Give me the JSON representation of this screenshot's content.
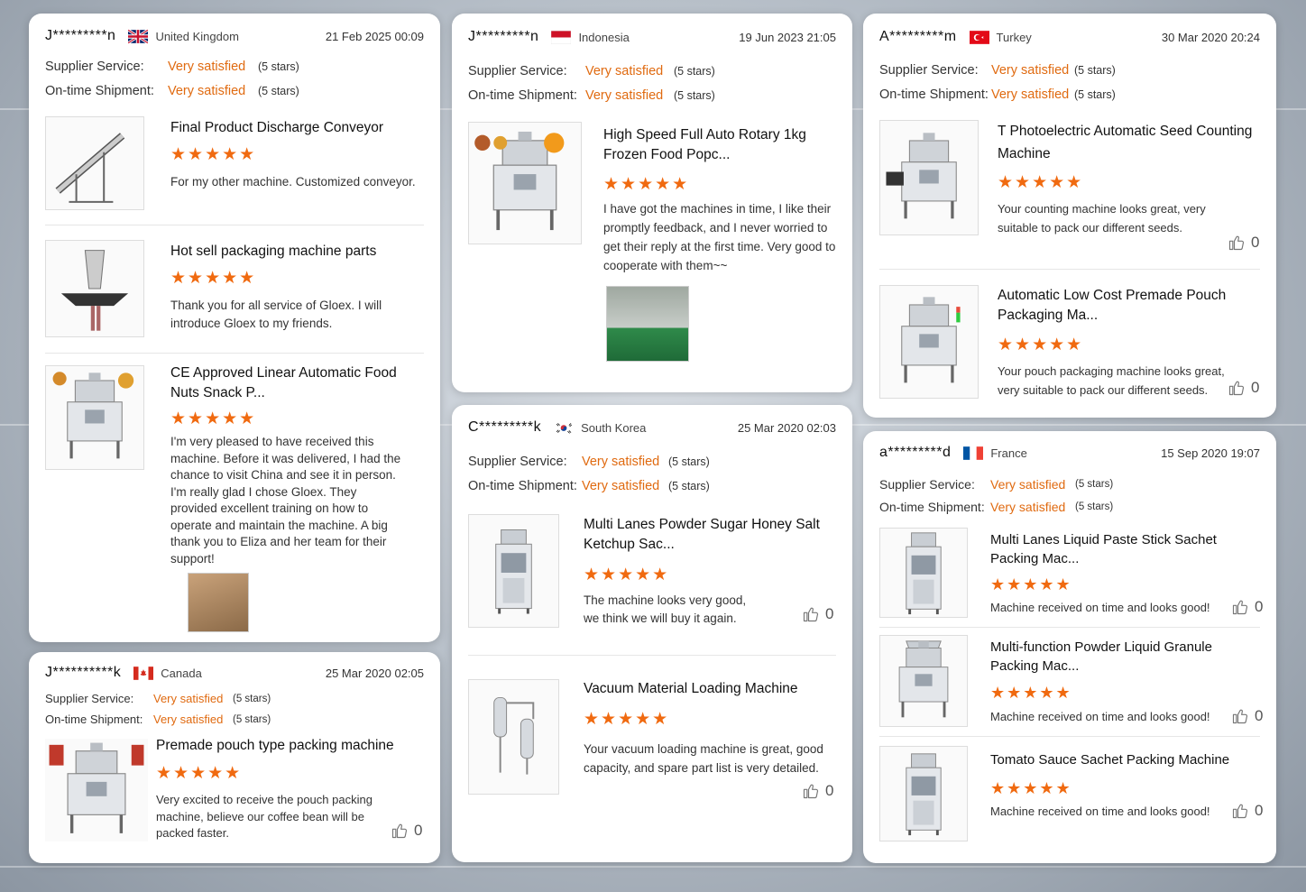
{
  "colors": {
    "accent": "#e06a10",
    "star": "#f06a10"
  },
  "labels": {
    "supplier": "Supplier Service:",
    "shipment": "On-time Shipment:",
    "sat": "Very satisfied",
    "stars5": "(5 stars)",
    "star_glyphs": "★★★★★"
  },
  "reviews": [
    {
      "user": "J*********n",
      "country": "United Kingdom",
      "flag": "uk",
      "date": "21 Feb 2025 00:09",
      "items": [
        {
          "title": "Final Product Discharge Conveyor",
          "comment": "For my other machine. Customized conveyor."
        },
        {
          "title": "Hot sell packaging machine parts",
          "comment": "Thank you for all service of Gloex. I will introduce Gloex to my friends."
        },
        {
          "title": "CE Approved Linear Automatic Food Nuts Snack P...",
          "comment": "I'm very pleased to have received this machine. Before it was delivered, I had the chance to visit China and see it in person. I'm really glad I chose Gloex. They provided excellent training on how to operate and maintain the machine. A big thank you to Eliza and her team for their support!"
        }
      ]
    },
    {
      "user": "J*********n",
      "country": "Indonesia",
      "flag": "id",
      "date": "19 Jun 2023 21:05",
      "items": [
        {
          "title": "High Speed Full Auto Rotary 1kg Frozen Food Popc...",
          "comment": "I have got the machines in time, I like their promptly feedback, and I never worried to get their reply at the first time. Very good to cooperate with them~~"
        }
      ]
    },
    {
      "user": "A*********m",
      "country": "Turkey",
      "flag": "tr",
      "date": "30 Mar 2020 20:24",
      "items": [
        {
          "title": "T Photoelectric Automatic Seed Counting Machine",
          "comment": "Your counting machine looks great, very suitable to pack our different seeds.",
          "likes": "0"
        },
        {
          "title": "Automatic Low Cost Premade Pouch Packaging Ma...",
          "comment": "Your pouch packaging machine looks great, very suitable to pack our different seeds.",
          "likes": "0"
        }
      ]
    },
    {
      "user": "C*********k",
      "country": "South Korea",
      "flag": "kr",
      "date": "25 Mar 2020 02:03",
      "items": [
        {
          "title": "Multi Lanes Powder Sugar Honey Salt Ketchup Sac...",
          "comment": "The machine looks very good, we think we will buy it again.",
          "likes": "0"
        },
        {
          "title": "Vacuum Material Loading Machine",
          "comment": "Your vacuum loading machine is great, good capacity, and spare part list is very detailed.",
          "likes": "0"
        }
      ]
    },
    {
      "user": "a*********d",
      "country": "France",
      "flag": "fr",
      "date": "15 Sep 2020 19:07",
      "items": [
        {
          "title": "Multi Lanes Liquid Paste Stick Sachet Packing Mac...",
          "comment": "Machine received on time and looks good!",
          "likes": "0"
        },
        {
          "title": "Multi-function Powder Liquid Granule Packing Mac...",
          "comment": "Machine received on time and looks good!",
          "likes": "0"
        },
        {
          "title": "Tomato Sauce Sachet Packing Machine",
          "comment": "Machine received on time and looks good!",
          "likes": "0"
        }
      ]
    },
    {
      "user": "J**********k",
      "country": "Canada",
      "flag": "ca",
      "date": "25 Mar 2020 02:05",
      "items": [
        {
          "title": "Premade pouch type packing machine",
          "comment": "Very excited to receive the pouch packing machine,  believe our coffee bean will be packed faster.",
          "likes": "0"
        }
      ]
    }
  ]
}
